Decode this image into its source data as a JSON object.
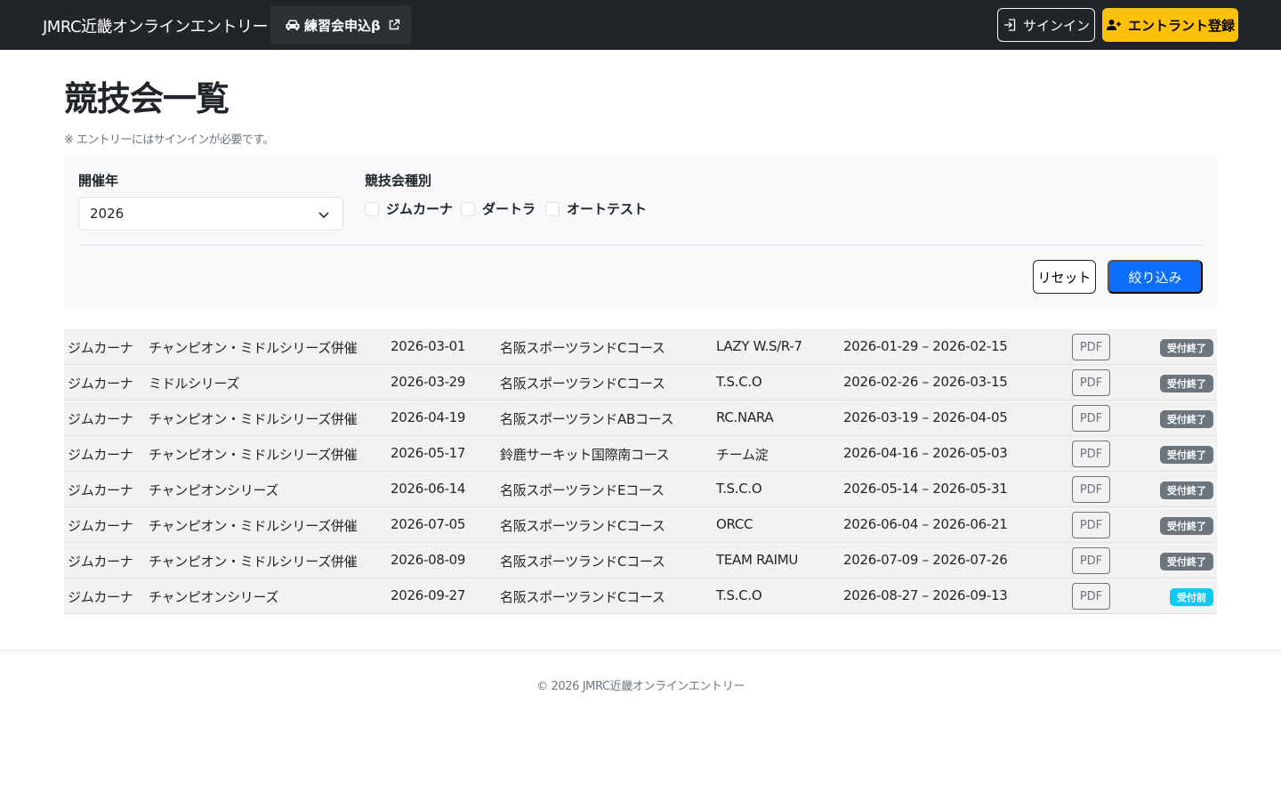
{
  "navbar": {
    "brand": "JMRC近畿オンラインエントリー",
    "practice_link": "練習会申込β",
    "signin_label": "サインイン",
    "register_label": "エントラント登録",
    "icons": {
      "practice": "car-icon",
      "external": "external-link-icon",
      "signin": "sign-in-icon",
      "register": "person-plus-icon"
    }
  },
  "page": {
    "title": "競技会一覧",
    "notice": "※ エントリーにはサインインが必要です。"
  },
  "filters": {
    "year_label": "開催年",
    "year_value": "2026",
    "type_label": "競技会種別",
    "types": [
      {
        "label": "ジムカーナ",
        "checked": false
      },
      {
        "label": "ダートラ",
        "checked": false
      },
      {
        "label": "オートテスト",
        "checked": false
      }
    ],
    "reset_label": "リセット",
    "apply_label": "絞り込み"
  },
  "events": [
    {
      "type": "ジムカーナ",
      "series": "チャンピオン・ミドルシリーズ併催",
      "date": "2026-03-01",
      "venue": "名阪スポーツランドCコース",
      "organizer": "LAZY W.S/R-7",
      "period": "2026-01-29 – 2026-02-15",
      "pdf": "PDF",
      "status": "受付終了",
      "status_kind": "closed"
    },
    {
      "type": "ジムカーナ",
      "series": "ミドルシリーズ",
      "date": "2026-03-29",
      "venue": "名阪スポーツランドCコース",
      "organizer": "T.S.C.O",
      "period": "2026-02-26 – 2026-03-15",
      "pdf": "PDF",
      "status": "受付終了",
      "status_kind": "closed"
    },
    {
      "type": "ジムカーナ",
      "series": "チャンピオン・ミドルシリーズ併催",
      "date": "2026-04-19",
      "venue": "名阪スポーツランドABコース",
      "organizer": "RC.NARA",
      "period": "2026-03-19 – 2026-04-05",
      "pdf": "PDF",
      "status": "受付終了",
      "status_kind": "closed"
    },
    {
      "type": "ジムカーナ",
      "series": "チャンピオン・ミドルシリーズ併催",
      "date": "2026-05-17",
      "venue": "鈴鹿サーキット国際南コース",
      "organizer": "チーム淀",
      "period": "2026-04-16 – 2026-05-03",
      "pdf": "PDF",
      "status": "受付終了",
      "status_kind": "closed"
    },
    {
      "type": "ジムカーナ",
      "series": "チャンピオンシリーズ",
      "date": "2026-06-14",
      "venue": "名阪スポーツランドEコース",
      "organizer": "T.S.C.O",
      "period": "2026-05-14 – 2026-05-31",
      "pdf": "PDF",
      "status": "受付終了",
      "status_kind": "closed"
    },
    {
      "type": "ジムカーナ",
      "series": "チャンピオン・ミドルシリーズ併催",
      "date": "2026-07-05",
      "venue": "名阪スポーツランドCコース",
      "organizer": "ORCC",
      "period": "2026-06-04 – 2026-06-21",
      "pdf": "PDF",
      "status": "受付終了",
      "status_kind": "closed"
    },
    {
      "type": "ジムカーナ",
      "series": "チャンピオン・ミドルシリーズ併催",
      "date": "2026-08-09",
      "venue": "名阪スポーツランドCコース",
      "organizer": "TEAM RAIMU",
      "period": "2026-07-09 – 2026-07-26",
      "pdf": "PDF",
      "status": "受付終了",
      "status_kind": "closed"
    },
    {
      "type": "ジムカーナ",
      "series": "チャンピオンシリーズ",
      "date": "2026-09-27",
      "venue": "名阪スポーツランドCコース",
      "organizer": "T.S.C.O",
      "period": "2026-08-27 – 2026-09-13",
      "pdf": "PDF",
      "status": "受付前",
      "status_kind": "before"
    }
  ],
  "colors": {
    "navbar_bg": "#212529",
    "warning": "#ffc107",
    "primary": "#0d6efd",
    "badge_closed": "#6c757d",
    "badge_before": "#0dcaf0"
  },
  "footer": {
    "text": "© 2026 JMRC近畿オンラインエントリー"
  }
}
